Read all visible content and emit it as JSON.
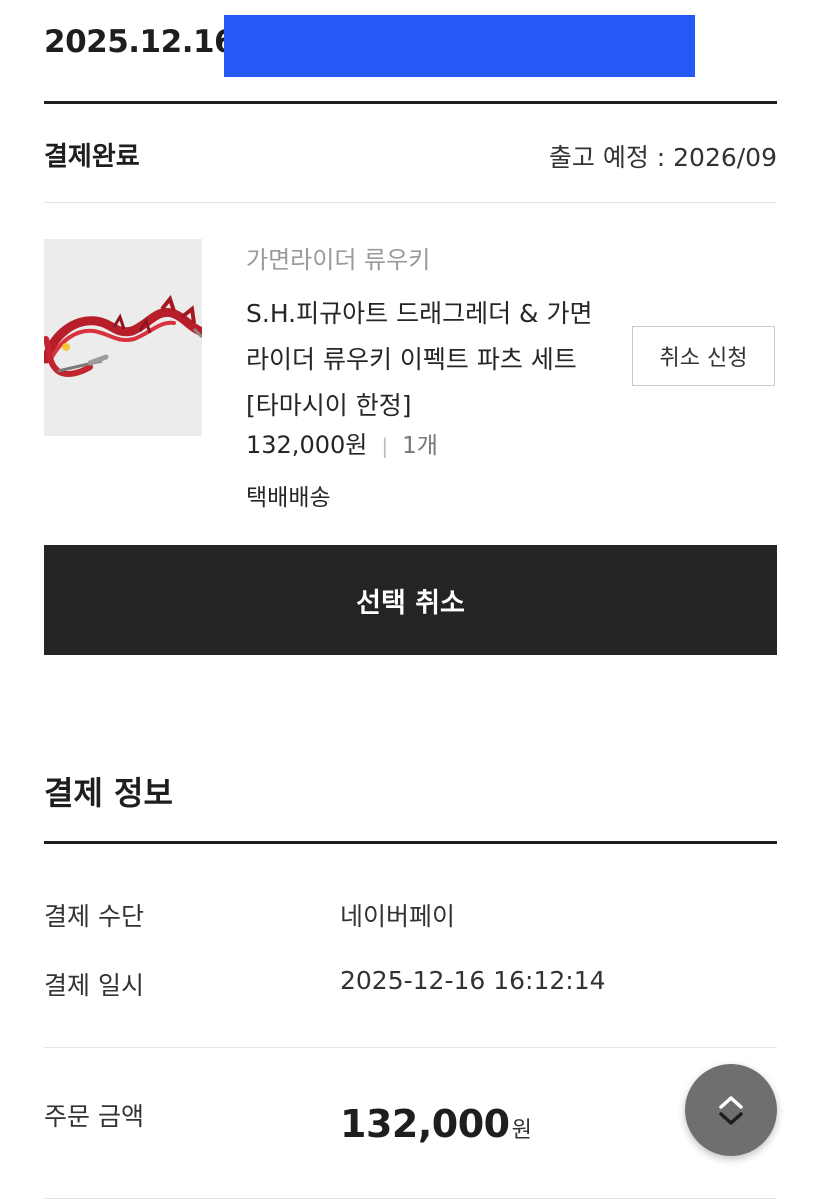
{
  "order": {
    "date": "2025.12.16",
    "status": "결제완료",
    "ship_label": "출고 예정 : ",
    "ship_date": "2026/09"
  },
  "item": {
    "brand": "가면라이더 류우키",
    "name": "S.H.피규아트 드래그레더 & 가면라이더 류우키 이펙트 파츠 세트 [타마시이 한정]",
    "price": "132,000원",
    "separator": "|",
    "quantity": "1개",
    "delivery": "택배배송",
    "cancel_request_label": "취소 신청"
  },
  "actions": {
    "select_cancel_label": "선택 취소"
  },
  "payment": {
    "title": "결제 정보",
    "rows": [
      {
        "label": "결제 수단",
        "value": "네이버페이"
      },
      {
        "label": "결제 일시",
        "value": "2025-12-16 16:12:14"
      }
    ],
    "total_label": "주문 금액",
    "total_amount": "132,000",
    "total_unit": "원"
  },
  "icons": {
    "scroll": "chevron-up-down-icon",
    "redaction_color": "#2459f5"
  }
}
